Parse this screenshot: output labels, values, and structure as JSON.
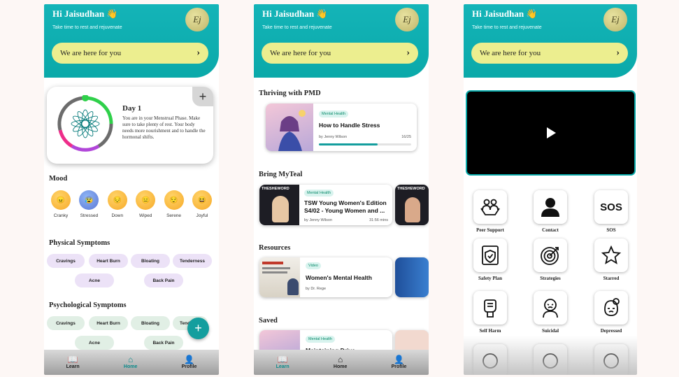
{
  "header": {
    "greeting": "Hi Jaisudhan 👋",
    "subtitle": "Take time to rest and rejuvenate",
    "avatar_initials": "Ej",
    "support_label": "We are here for you",
    "support_arrow": "›"
  },
  "nav": {
    "learn": "Learn",
    "home": "Home",
    "profile": "Profile"
  },
  "cycle": {
    "day": "Day 1",
    "description": "You are in your Menstrual Phase. Make sure to take plenty of rest. Your body needs more nourishment and to handle the hormonal shifts.",
    "add": "+"
  },
  "mood": {
    "title": "Mood",
    "items": [
      {
        "label": "Cranky",
        "face": "😠"
      },
      {
        "label": "Stressed",
        "face": "😰"
      },
      {
        "label": "Down",
        "face": "😔"
      },
      {
        "label": "Wiped",
        "face": "😑"
      },
      {
        "label": "Serene",
        "face": "😌"
      },
      {
        "label": "Joyful",
        "face": "😆"
      }
    ]
  },
  "physical": {
    "title": "Physical Symptoms",
    "chips": [
      "Cravings",
      "Heart Burn",
      "Bloating",
      "Tenderness",
      "Acne",
      "Back Pain"
    ]
  },
  "psych": {
    "title": "Psychological Symptoms",
    "chips": [
      "Cravings",
      "Heart Burn",
      "Bloating",
      "Tend",
      "Acne",
      "Back Pain"
    ]
  },
  "fab": "+",
  "learn": {
    "thriving": {
      "title": "Thriving with PMD",
      "tag": "Mental Health",
      "card_title": "How to Handle Stress",
      "author": "by Jenny Wilson",
      "progress_text": "16/25",
      "progress": 0.64
    },
    "bring": {
      "title": "Bring MyTeal",
      "tag": "Mental Health",
      "card_title": "TSW Young Women's Edition S4/02 - Young Women and ...",
      "author": "by Jenny Wilson",
      "duration": "31:56 mins",
      "thumb_text": "THESHEWORD"
    },
    "resources": {
      "title": "Resources",
      "tag": "Video",
      "card_title": "Women's Mental Health",
      "author": "by Dr. Rege"
    },
    "saved": {
      "title": "Saved",
      "tag": "Mental Health",
      "card_title": "Maintaining Drive"
    }
  },
  "tools": [
    {
      "label": "Peer Support",
      "icon": "peer-support-icon"
    },
    {
      "label": "Contact",
      "icon": "contact-icon"
    },
    {
      "label": "SOS",
      "icon": "sos-icon"
    },
    {
      "label": "Safety Plan",
      "icon": "safety-plan-icon"
    },
    {
      "label": "Strategies",
      "icon": "target-icon"
    },
    {
      "label": "Starred",
      "icon": "star-icon"
    },
    {
      "label": "Self Harm",
      "icon": "self-harm-icon"
    },
    {
      "label": "Suicidal",
      "icon": "suicidal-icon"
    },
    {
      "label": "Depressed",
      "icon": "depressed-icon"
    }
  ],
  "colors": {
    "teal": "#14b4b8",
    "yellow_button": "#ecee8f",
    "accent": "#149e9e"
  }
}
